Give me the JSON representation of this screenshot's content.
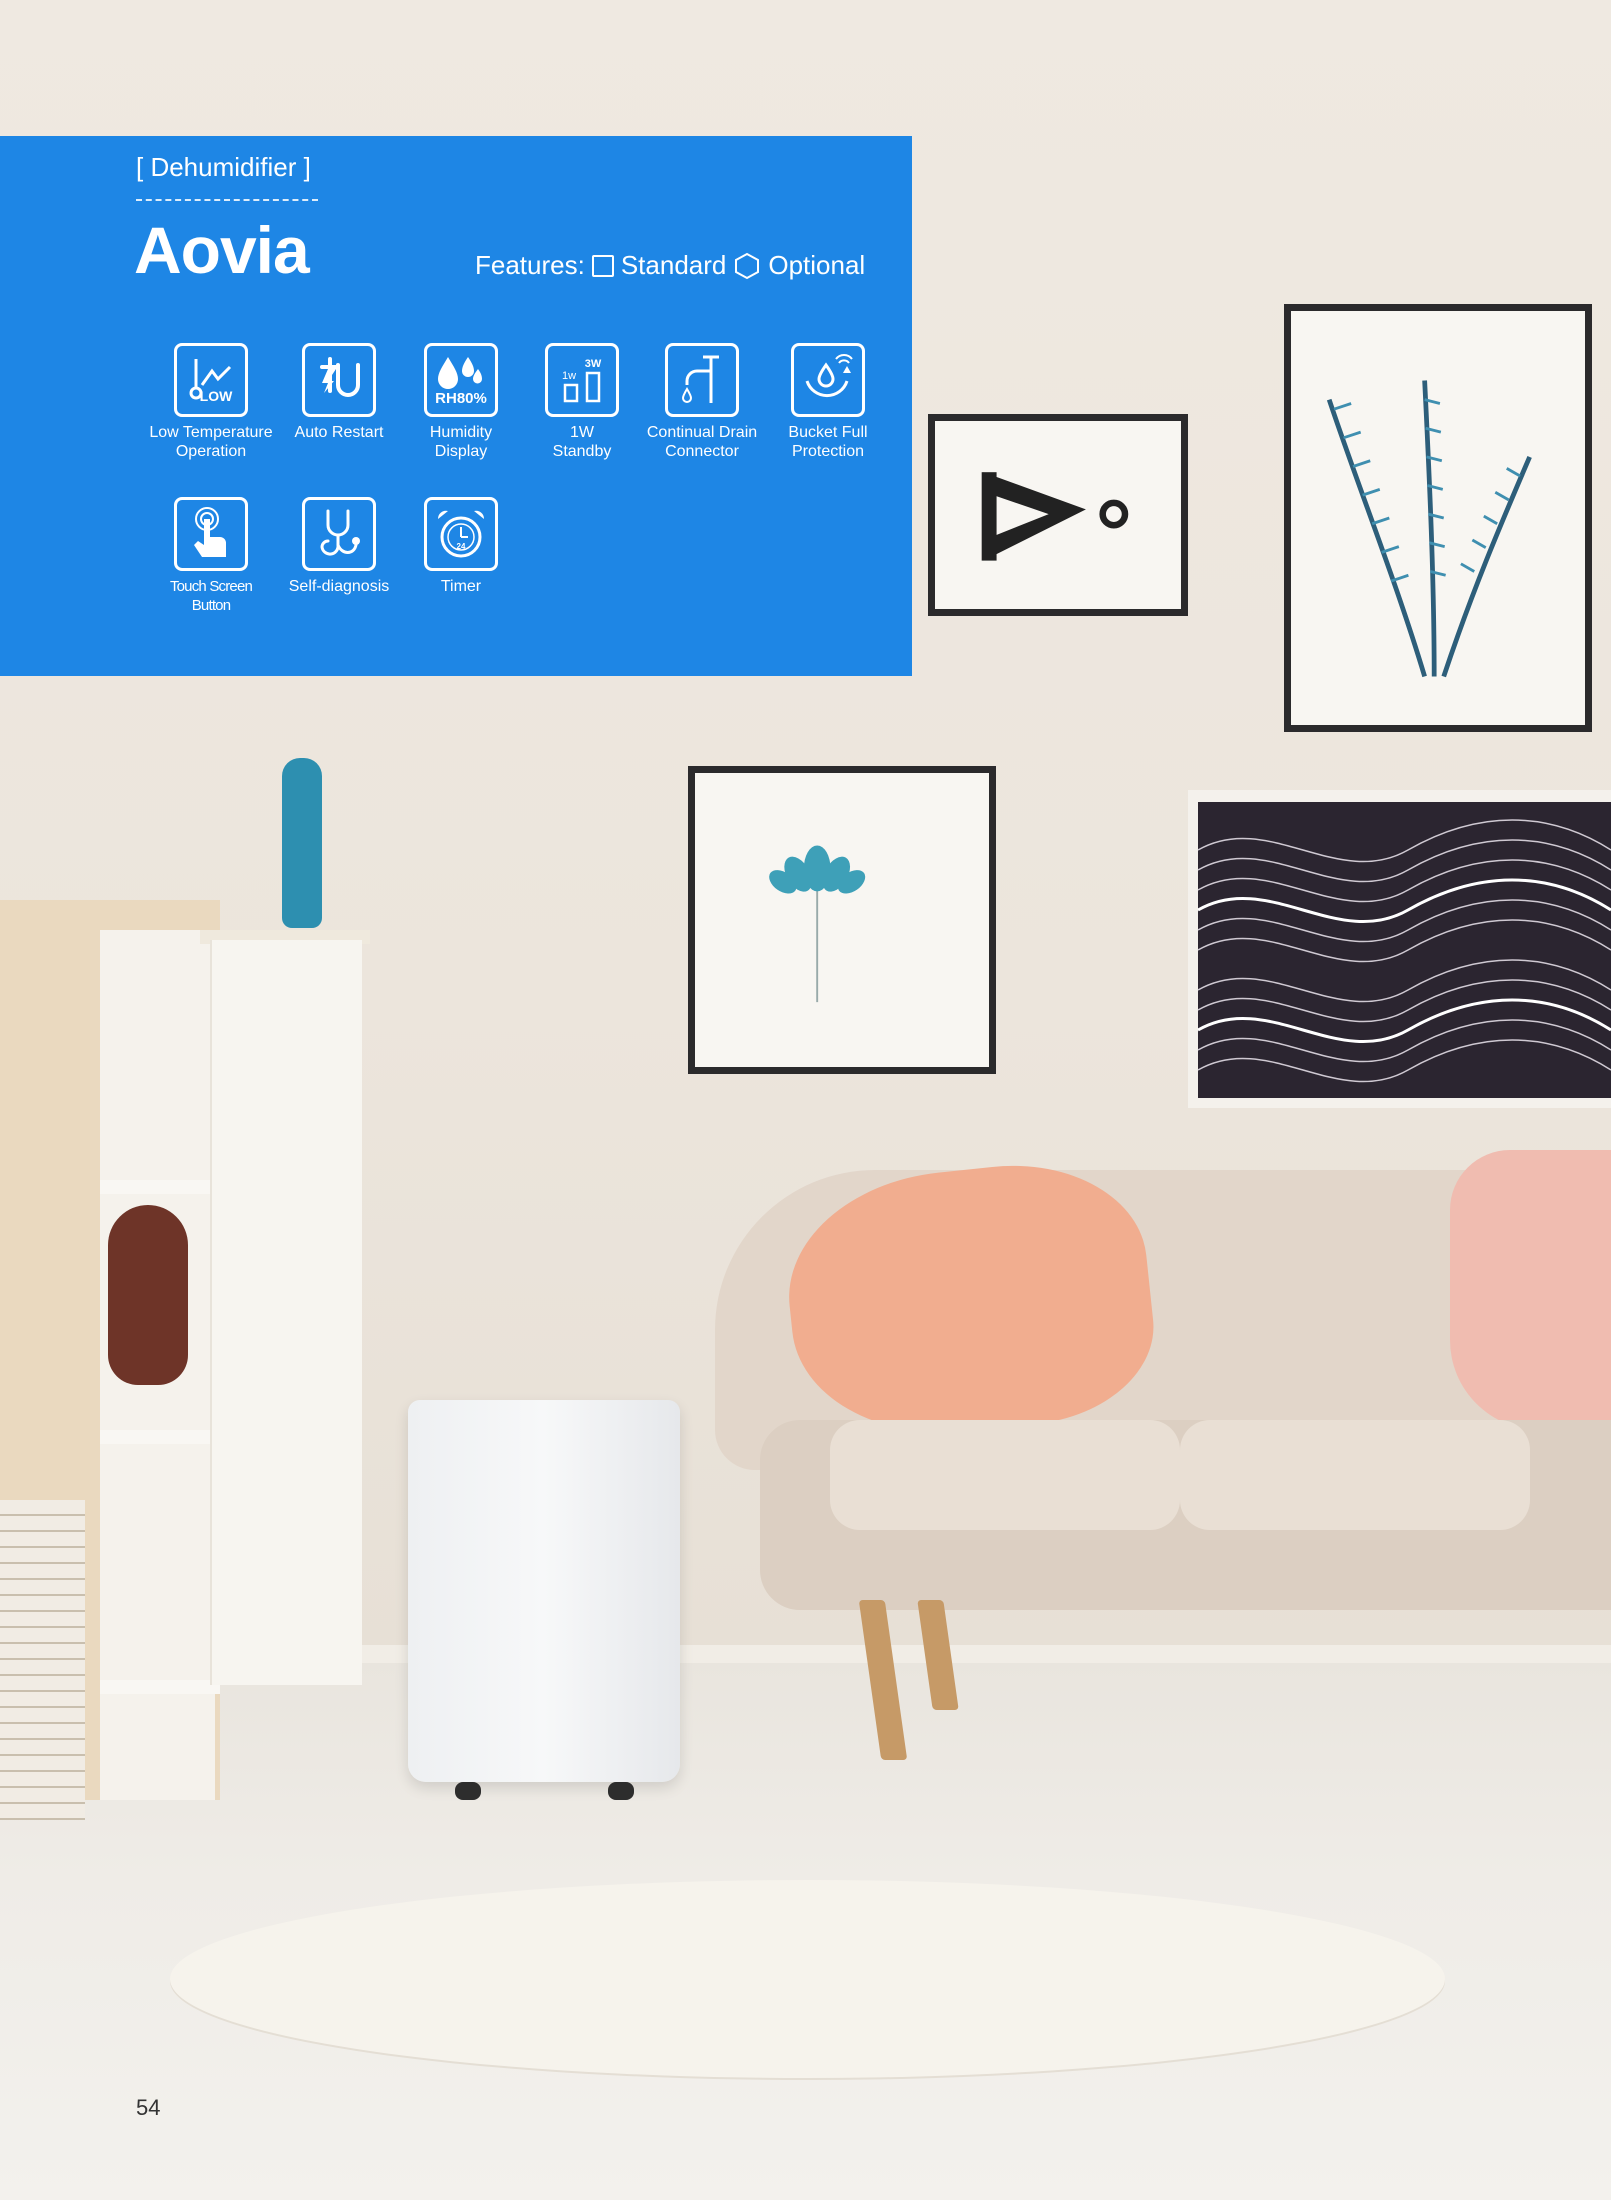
{
  "header": {
    "category": "[ Dehumidifier ]",
    "product_name": "Aovia",
    "features_label": "Features:",
    "legend_standard": "Standard",
    "legend_optional": "Optional"
  },
  "features": [
    {
      "icon": "low-temperature-icon",
      "label_line1": "Low Temperature",
      "label_line2": "Operation"
    },
    {
      "icon": "auto-restart-icon",
      "label_line1": "Auto Restart",
      "label_line2": ""
    },
    {
      "icon": "humidity-display-icon",
      "label_line1": "Humidity",
      "label_line2": "Display",
      "icon_text": "RH80%"
    },
    {
      "icon": "standby-icon",
      "label_line1": "1W",
      "label_line2": "Standby",
      "icon_text_a": "1w",
      "icon_text_b": "3W"
    },
    {
      "icon": "drain-connector-icon",
      "label_line1": "Continual Drain",
      "label_line2": "Connector"
    },
    {
      "icon": "bucket-full-icon",
      "label_line1": "Bucket Full",
      "label_line2": "Protection"
    },
    {
      "icon": "touch-screen-icon",
      "label_line1": "Touch Screen",
      "label_line2": "Button"
    },
    {
      "icon": "self-diagnosis-icon",
      "label_line1": "Self-diagnosis",
      "label_line2": ""
    },
    {
      "icon": "timer-icon",
      "label_line1": "Timer",
      "label_line2": "",
      "icon_text": "24"
    }
  ],
  "page_number": "54",
  "colors": {
    "panel_blue": "#1984E4",
    "text_white": "#FFFFFF"
  }
}
